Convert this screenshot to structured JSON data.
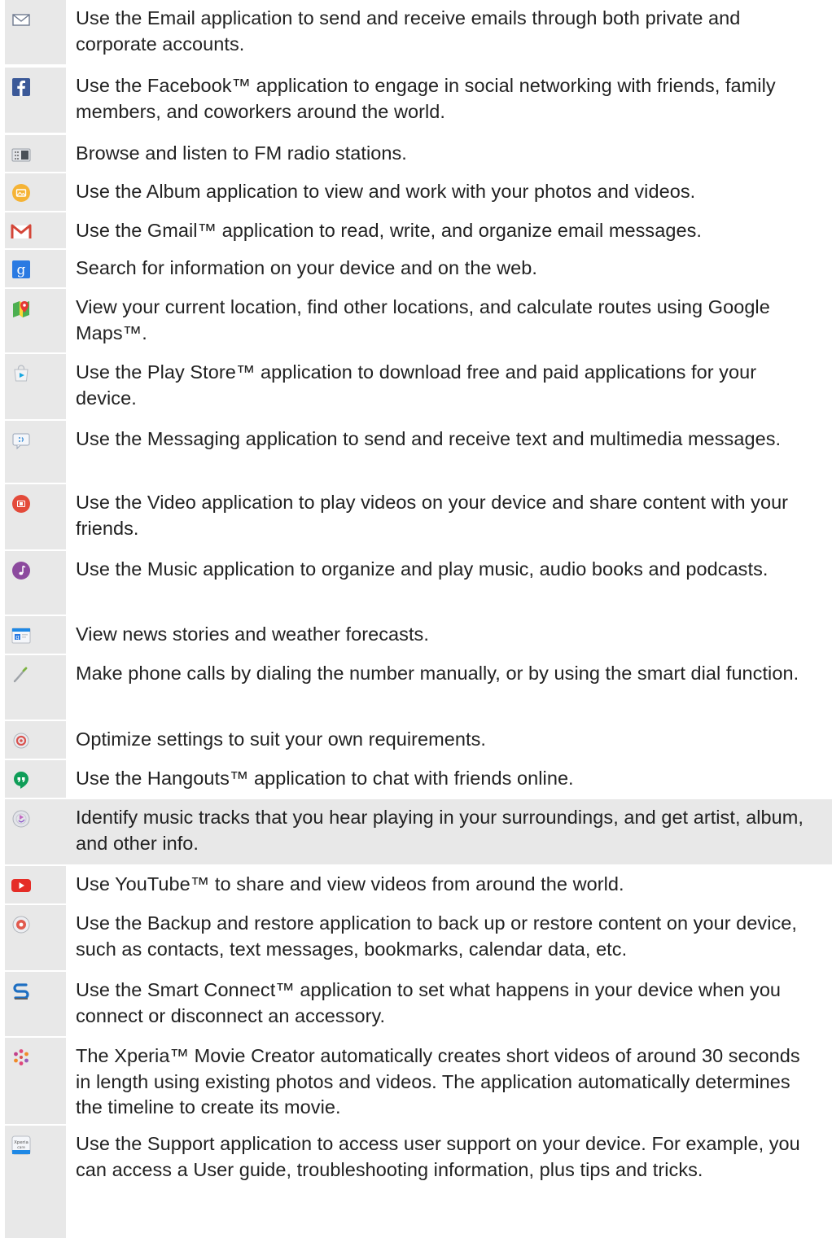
{
  "apps": [
    {
      "icon": "email-icon",
      "text": "Use the Email application to send and receive emails through both private and corporate accounts."
    },
    {
      "icon": "facebook-icon",
      "text": "Use the Facebook™ application to engage in social networking with friends, family members, and coworkers around the world."
    },
    {
      "icon": "fm-radio-icon",
      "text": "Browse and listen to FM radio stations."
    },
    {
      "icon": "album-icon",
      "text": "Use the Album application to view and work with your photos and videos."
    },
    {
      "icon": "gmail-icon",
      "text": "Use the Gmail™ application to read, write, and organize email messages."
    },
    {
      "icon": "google-search-icon",
      "text": "Search for information on your device and on the web."
    },
    {
      "icon": "google-maps-icon",
      "text": "View your current location, find other locations, and calculate routes using Google Maps™."
    },
    {
      "icon": "play-store-icon",
      "text": "Use the Play Store™ application to download free and paid applications for your device."
    },
    {
      "icon": "messaging-icon",
      "text": "Use the Messaging application to send and receive text and multimedia messages."
    },
    {
      "icon": "video-icon",
      "text": "Use the Video application to play videos on your device and share content with your friends."
    },
    {
      "icon": "music-icon",
      "text": "Use the Music application to organize and play music, audio books and podcasts."
    },
    {
      "icon": "news-weather-icon",
      "text": "View news stories and weather forecasts."
    },
    {
      "icon": "phone-icon",
      "text": "Make phone calls by dialing the number manually, or by using the smart dial function."
    },
    {
      "icon": "settings-icon",
      "text": "Optimize settings to suit your own requirements."
    },
    {
      "icon": "hangouts-icon",
      "text": "Use the Hangouts™ application to chat with friends online."
    },
    {
      "icon": "trackid-icon",
      "text": "Identify music tracks that you hear playing in your surroundings, and get artist, album, and other info.",
      "highlighted": true
    },
    {
      "icon": "youtube-icon",
      "text": "Use YouTube™ to share and view videos from around the world."
    },
    {
      "icon": "backup-restore-icon",
      "text": "Use the Backup and restore application to back up or restore content on your device, such as contacts, text messages, bookmarks, calendar data, etc."
    },
    {
      "icon": "smart-connect-icon",
      "text": "Use the Smart Connect™ application to set what happens in your device when you connect or disconnect an accessory."
    },
    {
      "icon": "movie-creator-icon",
      "text": "The Xperia™ Movie Creator automatically creates short videos of around 30 seconds in length using existing photos and videos. The application automatically determines the timeline to create its movie."
    },
    {
      "icon": "support-icon",
      "icon_label": "Xperia care",
      "text": "Use the Support application to access user support on your device. For example, you can access a User guide, troubleshooting information, plus tips and tricks."
    }
  ],
  "colors": {
    "cell_gray": "#e8e8e8",
    "text": "#222222",
    "email": "#6f7a8f",
    "facebook": "#3b5998",
    "album": "#f5b335",
    "gmail": "#d44638",
    "google": "#2a7ae2",
    "video": "#e34a3a",
    "music": "#8c4a9e",
    "hangouts": "#0f9d58",
    "youtube": "#e52d27"
  }
}
